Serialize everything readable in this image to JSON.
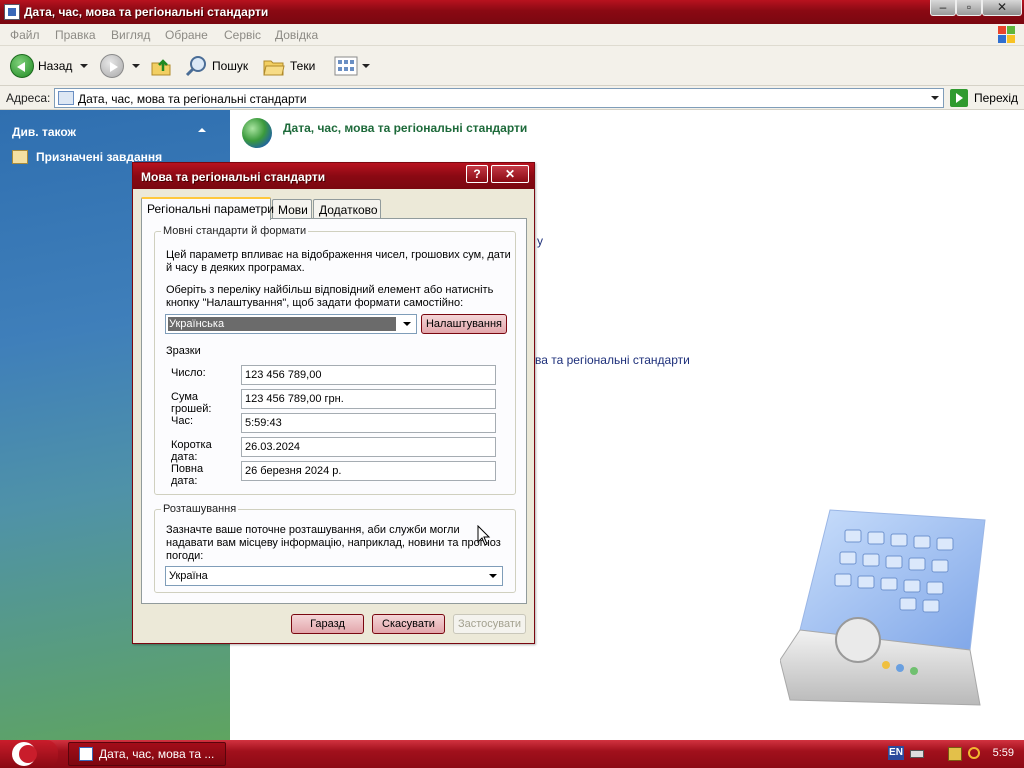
{
  "window": {
    "title": "Дата, час, мова та регіональні стандарти"
  },
  "menu": [
    "Файл",
    "Правка",
    "Вигляд",
    "Обране",
    "Сервіс",
    "Довідка"
  ],
  "toolbar": {
    "back_label": "Назад",
    "search_label": "Пошук",
    "folders_label": "Теки"
  },
  "address": {
    "label": "Адреса:",
    "value": "Дата, час, мова та регіональні стандарти",
    "go_label": "Перехід"
  },
  "sidebar": {
    "see_also": "Див. також",
    "task": "Призначені завдання"
  },
  "content": {
    "title": "Дата, час, мова та регіональні стандарти",
    "fragment1": "у",
    "fragment2": "ва та регіональні стандарти"
  },
  "dialog": {
    "title": "Мова та регіональні стандарти",
    "tabs": [
      "Регіональні параметри",
      "Мови",
      "Додатково"
    ],
    "formats": {
      "legend": "Мовні стандарти й формати",
      "desc1_line1": "Цей параметр впливає на відображення чисел, грошових сум, дати",
      "desc1_line2": "й часу в деяких програмах.",
      "desc2_line1": "Оберіть з переліку найбільш відповідний елемент або натисніть",
      "desc2_line2": "кнопку \"Налаштування\", щоб задати формати самостійно:",
      "selected": "Українська",
      "customize_button": "Налаштування"
    },
    "samples": {
      "heading": "Зразки",
      "rows": [
        {
          "label": "Число:",
          "value": "123 456 789,00"
        },
        {
          "label": "Сума грошей:",
          "value": "123 456 789,00 грн."
        },
        {
          "label": "Час:",
          "value": "5:59:43"
        },
        {
          "label": "Коротка дата:",
          "value": "26.03.2024"
        },
        {
          "label": "Повна дата:",
          "value": "26 березня 2024 р."
        }
      ]
    },
    "location": {
      "legend": "Розташування",
      "desc_line1": "Зазначте ваше поточне розташування, аби служби могли",
      "desc_line2": "надавати вам місцеву інформацію, наприклад, новини та прогноз",
      "desc_line3": "погоди:",
      "selected": "Україна"
    },
    "buttons": {
      "ok": "Гаразд",
      "cancel": "Скасувати",
      "apply": "Застосувати"
    }
  },
  "taskbar": {
    "task_title": "Дата, час, мова та ...",
    "lang": "EN",
    "clock": "5:59"
  },
  "colors": {
    "title_red": "#8a0913",
    "sidebar_blue": "#3f7fba",
    "link_green": "#1d6a3a",
    "dialog_bg": "#ece9d8"
  }
}
